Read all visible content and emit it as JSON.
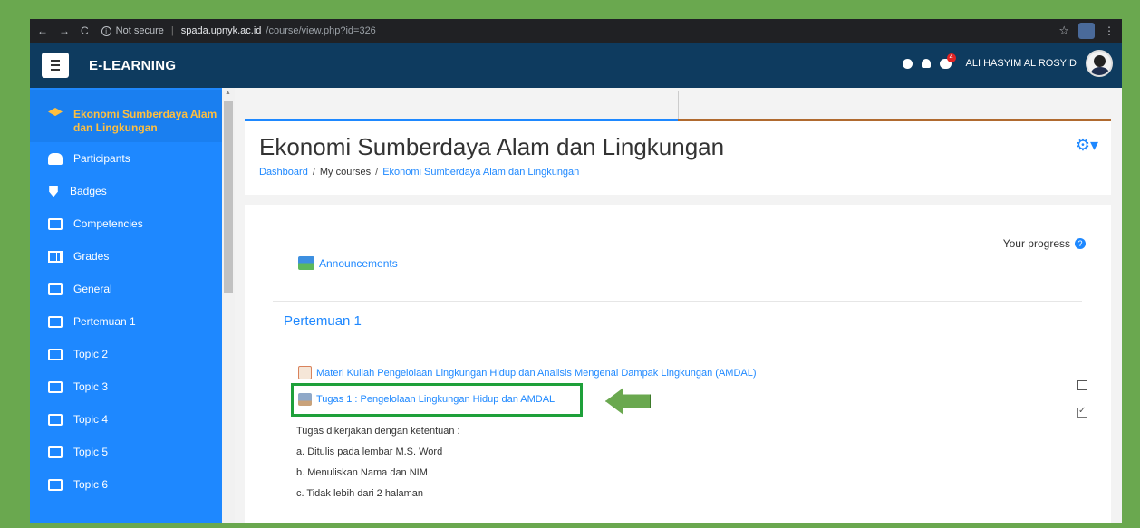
{
  "browser": {
    "back": "←",
    "forward": "→",
    "reload": "C",
    "security": "Not secure",
    "host": "spada.upnyk.ac.id",
    "path": "/course/view.php?id=326"
  },
  "navbar": {
    "brand": "E-LEARNING",
    "username": "ALI HASYIM AL ROSYID",
    "notification_badge": "4"
  },
  "sidebar": {
    "items": [
      {
        "label": "Ekonomi Sumberdaya Alam dan Lingkungan",
        "icon": "graduation-cap-icon"
      },
      {
        "label": "Participants",
        "icon": "users-icon"
      },
      {
        "label": "Badges",
        "icon": "shield-icon"
      },
      {
        "label": "Competencies",
        "icon": "checkbox-icon"
      },
      {
        "label": "Grades",
        "icon": "table-icon"
      },
      {
        "label": "General",
        "icon": "folder-icon"
      },
      {
        "label": "Pertemuan 1",
        "icon": "folder-icon"
      },
      {
        "label": "Topic 2",
        "icon": "folder-icon"
      },
      {
        "label": "Topic 3",
        "icon": "folder-icon"
      },
      {
        "label": "Topic 4",
        "icon": "folder-icon"
      },
      {
        "label": "Topic 5",
        "icon": "folder-icon"
      },
      {
        "label": "Topic 6",
        "icon": "folder-icon"
      }
    ]
  },
  "header": {
    "title": "Ekonomi Sumberdaya Alam dan Lingkungan",
    "breadcrumb": [
      "Dashboard",
      "My courses",
      "Ekonomi Sumberdaya Alam dan Lingkungan"
    ],
    "breadcrumb_sep": "/"
  },
  "content": {
    "progress_label": "Your progress",
    "announcements": "Announcements",
    "section_title": "Pertemuan 1",
    "activities": [
      {
        "label": "Materi Kuliah Pengelolaan Lingkungan Hidup dan Analisis Mengenai Dampak Lingkungan (AMDAL)",
        "icon": "pdf-icon",
        "completed": false
      },
      {
        "label": "Tugas 1 : Pengelolaan Lingkungan Hidup dan AMDAL",
        "icon": "assignment-icon",
        "completed": true
      }
    ],
    "description": [
      "Tugas dikerjakan dengan ketentuan :",
      "a. Ditulis pada lembar M.S. Word",
      "b. Menuliskan Nama dan NIM",
      "c. Tidak lebih dari 2 halaman"
    ]
  },
  "colors": {
    "frame": "#6aa84f",
    "navbar": "#0e3b5f",
    "sidebar": "#1e88ff",
    "active_label": "#ffbf3f",
    "highlight": "#1ea03a"
  }
}
